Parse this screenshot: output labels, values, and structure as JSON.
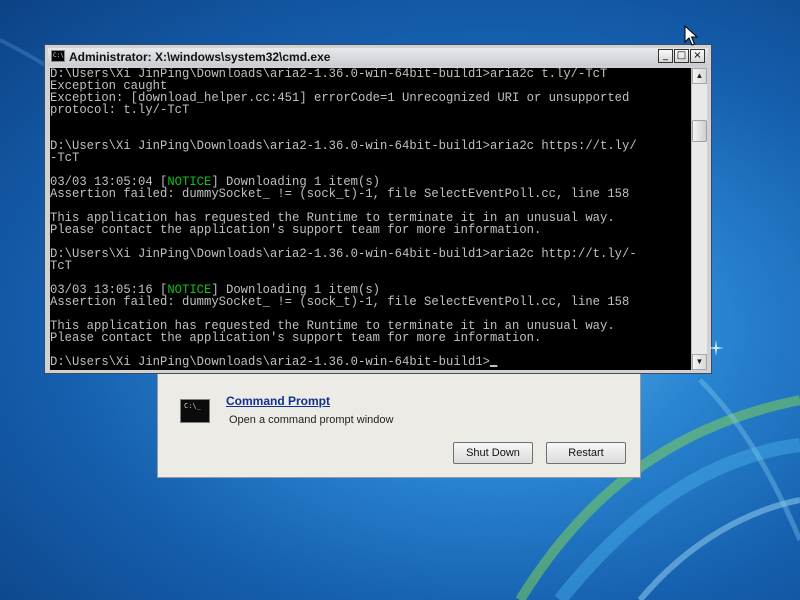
{
  "cmd_window": {
    "title": "Administrator: X:\\windows\\system32\\cmd.exe",
    "icon_label": "C:\\",
    "buttons": {
      "minimize": "_",
      "maximize": "□",
      "close": "×"
    },
    "console_lines": [
      "D:\\Users\\Xi JinPing\\Downloads\\aria2-1.36.0-win-64bit-build1>aria2c t.ly/-TcT",
      "Exception caught",
      "Exception: [download_helper.cc:451] errorCode=1 Unrecognized URI or unsupported",
      "protocol: t.ly/-TcT",
      "",
      "",
      "D:\\Users\\Xi JinPing\\Downloads\\aria2-1.36.0-win-64bit-build1>aria2c https://t.ly/",
      "-TcT",
      "",
      "03/03 13:05:04 [NOTICE] Downloading 1 item(s)",
      "Assertion failed: dummySocket_ != (sock_t)-1, file SelectEventPoll.cc, line 158",
      "",
      "This application has requested the Runtime to terminate it in an unusual way.",
      "Please contact the application's support team for more information.",
      "",
      "D:\\Users\\Xi JinPing\\Downloads\\aria2-1.36.0-win-64bit-build1>aria2c http://t.ly/-",
      "TcT",
      "",
      "03/03 13:05:16 [NOTICE] Downloading 1 item(s)",
      "Assertion failed: dummySocket_ != (sock_t)-1, file SelectEventPoll.cc, line 158",
      "",
      "This application has requested the Runtime to terminate it in an unusual way.",
      "Please contact the application's support team for more information.",
      "",
      "D:\\Users\\Xi JinPing\\Downloads\\aria2-1.36.0-win-64bit-build1>"
    ],
    "notice_word": "NOTICE",
    "colors": {
      "console_bg": "#000000",
      "console_text": "#c0c0c0",
      "notice": "#13c113"
    },
    "scrollbar": {
      "up_arrow": "▲",
      "down_arrow": "▼"
    }
  },
  "recovery_dialog": {
    "item_title": "Command Prompt",
    "item_description": "Open a command prompt window",
    "icon_label": "C:\\_",
    "shutdown_label": "Shut Down",
    "restart_label": "Restart"
  },
  "desktop": {
    "wallpaper_color": "#1d6cbf"
  }
}
